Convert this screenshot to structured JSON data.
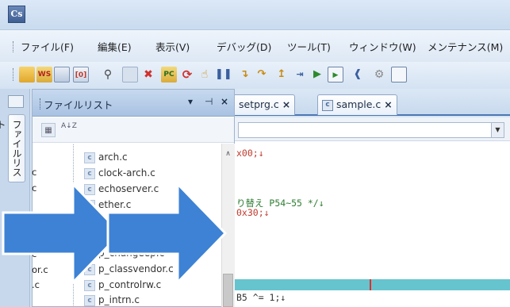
{
  "app": {
    "icon_label": "Cs"
  },
  "menu": {
    "items": [
      "ファイル(F)",
      "編集(E)",
      "表示(V)",
      "デバッグ(D)",
      "ツール(T)",
      "ウィンドウ(W)",
      "メンテナンス(M)"
    ],
    "underline_keys": [
      "F",
      "E",
      "V",
      "D",
      "T",
      "W",
      "M"
    ]
  },
  "toolbar": {
    "buttons": [
      "new-file",
      "ws",
      "open",
      "split",
      "search",
      "stop-red",
      "red-x",
      "pc",
      "refresh",
      "pointer",
      "pause",
      "step-into",
      "step-over",
      "step-out",
      "run-to",
      "run",
      "window",
      "watch",
      "settings",
      "memory"
    ],
    "labels": {
      "ws": "WS",
      "pc": "PC"
    }
  },
  "side_strip": {
    "tab_label": "ファイルリスト"
  },
  "file_panel": {
    "title": "ファイルリスト",
    "header_buttons": {
      "dropdown": "▾",
      "pin": "ᵩ",
      "close": "×"
    },
    "sort_icon": "A↓Z",
    "left_column": [
      "c",
      "c",
      "",
      "",
      "c",
      "or.c",
      ".c"
    ],
    "files": [
      "arch.c",
      "clock-arch.c",
      "echoserver.c",
      "ether.c",
      "",
      "",
      "p_changeep.c",
      "p_classvendor.c",
      "p_controlrw.c",
      "p_intrn.c"
    ]
  },
  "editor": {
    "tabs": [
      {
        "label": "setprg.c",
        "close": "×"
      },
      {
        "label": "sample.c",
        "close": "×"
      }
    ],
    "code_lines": [
      {
        "text": "x00;↓",
        "style": "red"
      },
      {
        "text": "り替え P54~55 */↓",
        "style": "green"
      },
      {
        "text": "0x30;↓",
        "style": "red"
      },
      {
        "text": "B5 ^= 1;↓",
        "style": "normal"
      }
    ]
  },
  "colors": {
    "accent": "#4b77b3",
    "arrow_fill": "#3d82d4",
    "highlight_line": "#66c4cf",
    "breakpoint_mark": "#e0302b"
  }
}
